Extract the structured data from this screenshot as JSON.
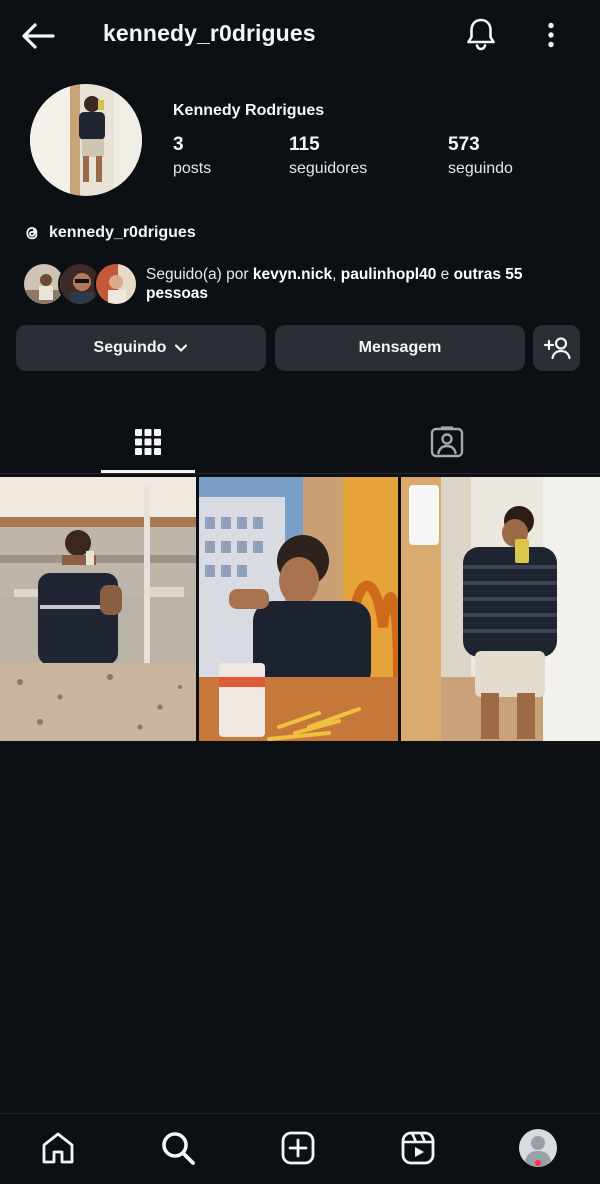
{
  "header": {
    "username": "kennedy_r0drigues",
    "back_icon": "arrow-left-icon",
    "bell_icon": "bell-icon",
    "more_icon": "more-vertical-icon"
  },
  "profile": {
    "display_name": "Kennedy Rodrigues",
    "stats": {
      "posts_count": "3",
      "posts_label": "posts",
      "followers_count": "115",
      "followers_label": "seguidores",
      "following_count": "573",
      "following_label": "seguindo"
    },
    "threads_handle": "kennedy_r0drigues"
  },
  "mutuals": {
    "prefix": "Seguido(a) por ",
    "user1": "kevyn.nick",
    "sep": ", ",
    "user2": "paulinhopl40",
    "conj": " e ",
    "others": "outras 55 pessoas"
  },
  "actions": {
    "following_label": "Seguindo",
    "message_label": "Mensagem"
  },
  "tabs": {
    "grid_icon": "grid-icon",
    "tagged_icon": "tagged-person-icon"
  },
  "nav": {
    "items": [
      "home-icon",
      "search-icon",
      "create-icon",
      "reels-icon",
      "profile-icon"
    ]
  },
  "colors": {
    "background": "#0c1014",
    "button": "#2a2e35",
    "notification": "#ff3040"
  }
}
